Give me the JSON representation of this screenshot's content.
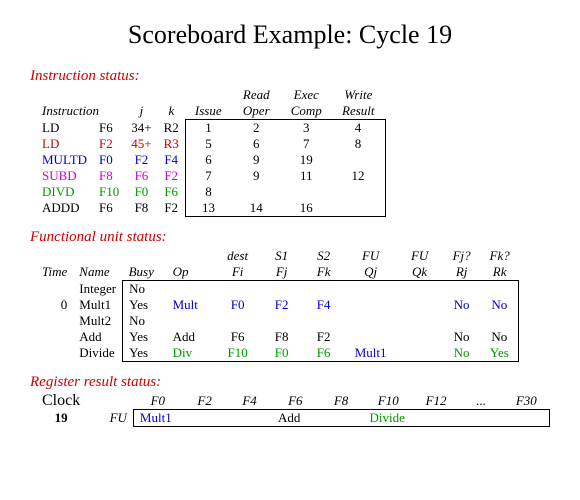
{
  "title": "Scoreboard Example: Cycle 19",
  "sections": {
    "instr": "Instruction status:",
    "fu": "Functional unit status:",
    "rr": "Register result status:"
  },
  "instr": {
    "hdr": {
      "instruction": "Instruction",
      "j": "j",
      "k": "k",
      "issue": "Issue",
      "read": "Read Oper",
      "exec": "Exec Comp",
      "write": "Write Result"
    },
    "rows": [
      {
        "op": "LD",
        "d": "F6",
        "j": "34+",
        "k": "R2",
        "issue": "1",
        "read": "2",
        "exec": "3",
        "write": "4",
        "cls": "c-black"
      },
      {
        "op": "LD",
        "d": "F2",
        "j": "45+",
        "k": "R3",
        "issue": "5",
        "read": "6",
        "exec": "7",
        "write": "8",
        "cls": "c-red"
      },
      {
        "op": "MULTD",
        "d": "F0",
        "j": "F2",
        "k": "F4",
        "issue": "6",
        "read": "9",
        "exec": "19",
        "write": "",
        "cls": "c-blue"
      },
      {
        "op": "SUBD",
        "d": "F8",
        "j": "F6",
        "k": "F2",
        "issue": "7",
        "read": "9",
        "exec": "11",
        "write": "12",
        "cls": "c-magenta"
      },
      {
        "op": "DIVD",
        "d": "F10",
        "j": "F0",
        "k": "F6",
        "issue": "8",
        "read": "",
        "exec": "",
        "write": "",
        "cls": "c-green"
      },
      {
        "op": "ADDD",
        "d": "F6",
        "j": "F8",
        "k": "F2",
        "issue": "13",
        "read": "14",
        "exec": "16",
        "write": "",
        "cls": "c-black"
      }
    ]
  },
  "fu": {
    "hdr": {
      "time": "Time",
      "name": "Name",
      "busy": "Busy",
      "op": "Op",
      "fi": "Fi",
      "fj": "Fj",
      "fk": "Fk",
      "qj": "Qj",
      "qk": "Qk",
      "rj": "Rj",
      "rk": "Rk",
      "dest": "dest",
      "s1": "S1",
      "s2": "S2",
      "fuA": "FU",
      "fuB": "FU",
      "fjq": "Fj?",
      "fkq": "Fk?"
    },
    "rows": [
      {
        "time": "",
        "name": "Integer",
        "busy": "No",
        "op": "",
        "fi": "",
        "fj": "",
        "fk": "",
        "qj": "",
        "qk": "",
        "rj": "",
        "rk": ""
      },
      {
        "time": "0",
        "name": "Mult1",
        "busy": "Yes",
        "op": "Mult",
        "fi": "F0",
        "fj": "F2",
        "fk": "F4",
        "qj": "",
        "qk": "",
        "rj": "No",
        "rk": "No",
        "cls": "c-blue"
      },
      {
        "time": "",
        "name": "Mult2",
        "busy": "No",
        "op": "",
        "fi": "",
        "fj": "",
        "fk": "",
        "qj": "",
        "qk": "",
        "rj": "",
        "rk": ""
      },
      {
        "time": "",
        "name": "Add",
        "busy": "Yes",
        "op": "Add",
        "fi": "F6",
        "fj": "F8",
        "fk": "F2",
        "qj": "",
        "qk": "",
        "rj": "No",
        "rk": "No",
        "cls": "c-black"
      },
      {
        "time": "",
        "name": "Divide",
        "busy": "Yes",
        "op": "Div",
        "fi": "F10",
        "fj": "F0",
        "fk": "F6",
        "qj": "Mult1",
        "qk": "",
        "rj": "No",
        "rk": "Yes",
        "cls": "c-green",
        "qjcls": "c-blue"
      }
    ]
  },
  "rr": {
    "clockLabel": "Clock",
    "clock": "19",
    "fuLabel": "FU",
    "regs": [
      "F0",
      "F2",
      "F4",
      "F6",
      "F8",
      "F10",
      "F12",
      "...",
      "F30"
    ],
    "vals": [
      {
        "t": "Mult1",
        "cls": "c-blue"
      },
      {
        "t": ""
      },
      {
        "t": ""
      },
      {
        "t": "Add"
      },
      {
        "t": ""
      },
      {
        "t": "Divide",
        "cls": "c-green"
      },
      {
        "t": ""
      },
      {
        "t": ""
      },
      {
        "t": ""
      }
    ]
  }
}
